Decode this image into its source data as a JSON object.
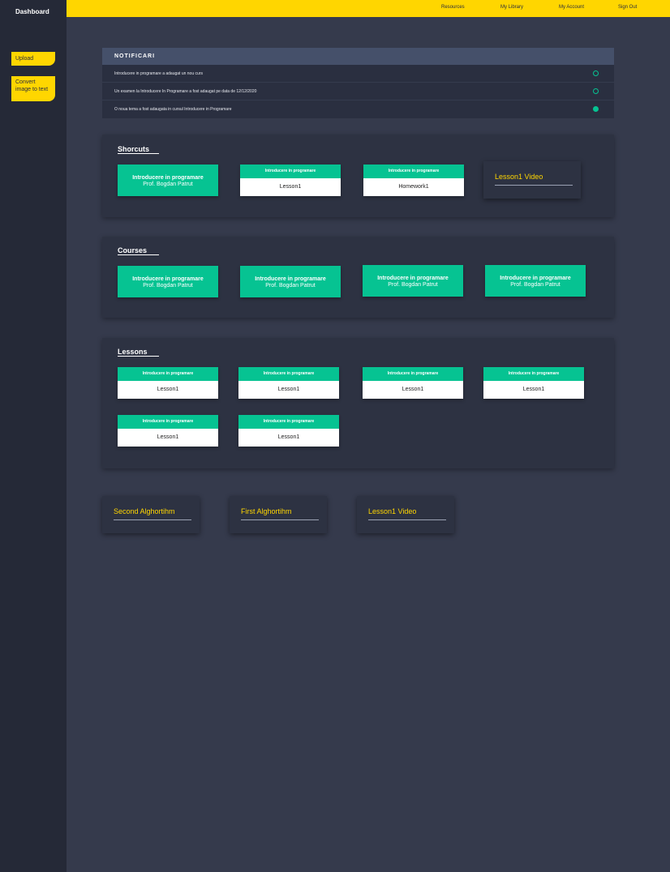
{
  "sidebar": {
    "title": "Dashboard",
    "buttons": [
      "Upload",
      "Convert image to text"
    ]
  },
  "topnav": [
    "Resources",
    "My Library",
    "My Account",
    "Sign Out"
  ],
  "notifications": {
    "title": "NOTIFICARI",
    "items": [
      {
        "text": "Introducere in programare a adaugat un nou curs",
        "read": false
      },
      {
        "text": "Un examen la Introducere In Programare a fost adaugat pe data de 12/12/2020",
        "read": false
      },
      {
        "text": "O noua tema a fost adaugata in cursul Introducere in Programare",
        "read": true
      }
    ]
  },
  "shortcuts": {
    "title": "Shorcuts",
    "course": {
      "title": "Introducere in programare",
      "subtitle": "Prof. Bogdan Patrut"
    },
    "lessons": [
      {
        "course": "Introducere in programare",
        "name": "Lesson1"
      },
      {
        "course": "Introducere in programare",
        "name": "Homework1"
      }
    ],
    "video": "Lesson1 Video"
  },
  "courses": {
    "title": "Courses",
    "items": [
      {
        "title": "Introducere in programare",
        "subtitle": "Prof. Bogdan Patrut"
      },
      {
        "title": "Introducere in programare",
        "subtitle": "Prof. Bogdan Patrut"
      },
      {
        "title": "Introducere in programare",
        "subtitle": "Prof. Bogdan Patrut"
      },
      {
        "title": "Introducere in programare",
        "subtitle": "Prof. Bogdan Patrut"
      }
    ]
  },
  "lessons": {
    "title": "Lessons",
    "items": [
      {
        "course": "Introducere in programare",
        "name": "Lesson1"
      },
      {
        "course": "Introducere in programare",
        "name": "Lesson1"
      },
      {
        "course": "Introducere in programare",
        "name": "Lesson1"
      },
      {
        "course": "Introducere in programare",
        "name": "Lesson1"
      },
      {
        "course": "Introducere in programare",
        "name": "Lesson1"
      },
      {
        "course": "Introducere in programare",
        "name": "Lesson1"
      }
    ]
  },
  "bottom_links": [
    "Second Alghortihm",
    "First Alghortihm",
    "Lesson1 Video"
  ],
  "colors": {
    "accent": "#ffd600",
    "green": "#06c392",
    "background": "#353a4c",
    "sidebar": "#252937"
  }
}
